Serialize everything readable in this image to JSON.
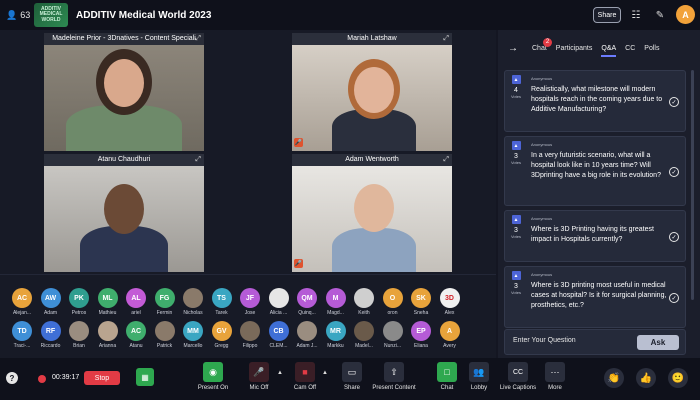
{
  "header": {
    "participant_count": "63",
    "logo_text": "ADDITIV MEDICAL WORLD",
    "title": "ADDITIV Medical World 2023",
    "share_label": "Share"
  },
  "tiles": [
    {
      "name": "Madeleine Prior - 3Dnatives - Content Speciali"
    },
    {
      "name": "Mariah Latshaw"
    },
    {
      "name": "Atanu Chaudhuri"
    },
    {
      "name": "Adam Wentworth"
    }
  ],
  "participants_row1": [
    {
      "initials": "AC",
      "name": "Alejan...",
      "color": "#e8a33b"
    },
    {
      "initials": "AW",
      "name": "Adam",
      "color": "#3f8fd6"
    },
    {
      "initials": "PK",
      "name": "Petros",
      "color": "#2f9e8f"
    },
    {
      "initials": "ML",
      "name": "Mathieu",
      "color": "#3fae6d"
    },
    {
      "initials": "AL",
      "name": "ariel",
      "color": "#c35bd6"
    },
    {
      "initials": "FG",
      "name": "Fermin",
      "color": "#3fae6d"
    },
    {
      "initials": "",
      "name": "Nicholas",
      "color": "#8a7a6a"
    },
    {
      "initials": "TS",
      "name": "Tarek",
      "color": "#3aa6c2"
    },
    {
      "initials": "JF",
      "name": "Jose",
      "color": "#b55bd6"
    },
    {
      "initials": "",
      "name": "Alicia ...",
      "color": "#e6e6e6"
    },
    {
      "initials": "QM",
      "name": "Quinq...",
      "color": "#b55bd6"
    },
    {
      "initials": "M",
      "name": "Magd...",
      "color": "#b55bd6"
    },
    {
      "initials": "",
      "name": "Keith",
      "color": "#cfcfcf"
    },
    {
      "initials": "O",
      "name": "oron",
      "color": "#e8a33b"
    },
    {
      "initials": "SK",
      "name": "Sneha",
      "color": "#e8a33b"
    },
    {
      "initials": "3D",
      "name": "Alex",
      "color": "#f0f0f0"
    }
  ],
  "participants_row2": [
    {
      "initials": "TD",
      "name": "Traci-...",
      "color": "#3f8fd6"
    },
    {
      "initials": "RF",
      "name": "Riccardo",
      "color": "#3f6fd6"
    },
    {
      "initials": "",
      "name": "Brian",
      "color": "#9a8d80"
    },
    {
      "initials": "",
      "name": "Arianna",
      "color": "#b9a48f"
    },
    {
      "initials": "AC",
      "name": "Atanu",
      "color": "#3fae6d"
    },
    {
      "initials": "",
      "name": "Patrick",
      "color": "#8a7a6a"
    },
    {
      "initials": "MM",
      "name": "Marcello",
      "color": "#3aa6c2"
    },
    {
      "initials": "GV",
      "name": "Gregg",
      "color": "#e8a33b"
    },
    {
      "initials": "",
      "name": "Filippo",
      "color": "#7a6a5a"
    },
    {
      "initials": "CB",
      "name": "CLEM...",
      "color": "#3f6fd6"
    },
    {
      "initials": "",
      "name": "Adam J...",
      "color": "#9a8d80"
    },
    {
      "initials": "MR",
      "name": "Markku",
      "color": "#3aa6c2"
    },
    {
      "initials": "",
      "name": "Madel...",
      "color": "#6a5a4a"
    },
    {
      "initials": "",
      "name": "Nunzi...",
      "color": "#8a8a8a"
    },
    {
      "initials": "EP",
      "name": "Eliana",
      "color": "#b55bd6"
    },
    {
      "initials": "A",
      "name": "Avery",
      "color": "#e8a33b"
    }
  ],
  "panel": {
    "tabs": [
      "Chat",
      "Participants",
      "Q&A",
      "CC",
      "Polls"
    ],
    "chat_badge": "2",
    "questions": [
      {
        "author": "Anonymous",
        "votes": "4",
        "votes_label": "Votes",
        "text": "Realistically, what milestone will modern hospitals reach in the coming years due to Additive Manufacturing?"
      },
      {
        "author": "Anonymous",
        "votes": "3",
        "votes_label": "Votes",
        "text": "In a very futuristic scenario, what will a hospital look like in 10 years time? Will 3Dprinting have a big role in its evolution?"
      },
      {
        "author": "Anonymous",
        "votes": "3",
        "votes_label": "Votes",
        "text": "Where is 3D Printing having its greatest impact in Hospitals currently?"
      },
      {
        "author": "Anonymous",
        "votes": "3",
        "votes_label": "Votes",
        "text": "Where is 3D printing most useful in medical cases at hospital? Is it for surgical planning, prosthetics, etc.?"
      }
    ],
    "ask_placeholder": "Enter Your Question",
    "ask_label": "Ask"
  },
  "bottom": {
    "timer": "00:39:17",
    "stop_label": "Stop",
    "controls": {
      "present_on": "Present On",
      "mic_off": "Mic Off",
      "cam_off": "Cam Off",
      "share": "Share",
      "present_content": "Present Content",
      "chat": "Chat",
      "lobby": "Lobby",
      "live_captions": "Live Captions",
      "more": "More"
    }
  }
}
